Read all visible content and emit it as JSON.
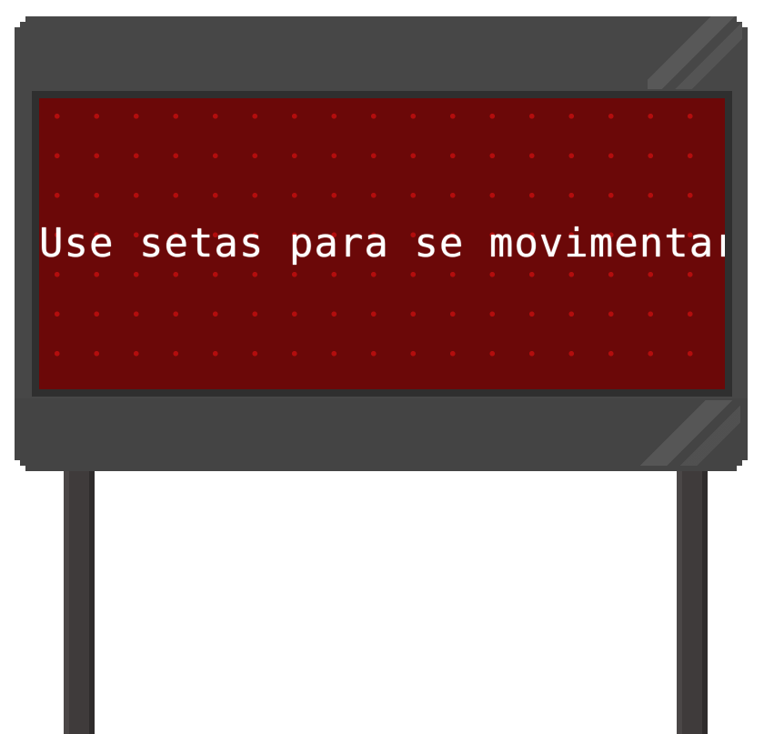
{
  "sign": {
    "message": "Use setas para se movimentar"
  },
  "colors": {
    "housing": "#474747",
    "bezel": "#2f2f2f",
    "led_background": "#6b0808",
    "led_dot": "#b30d0d",
    "text": "#ffffff",
    "post": "#3f3b3b"
  }
}
